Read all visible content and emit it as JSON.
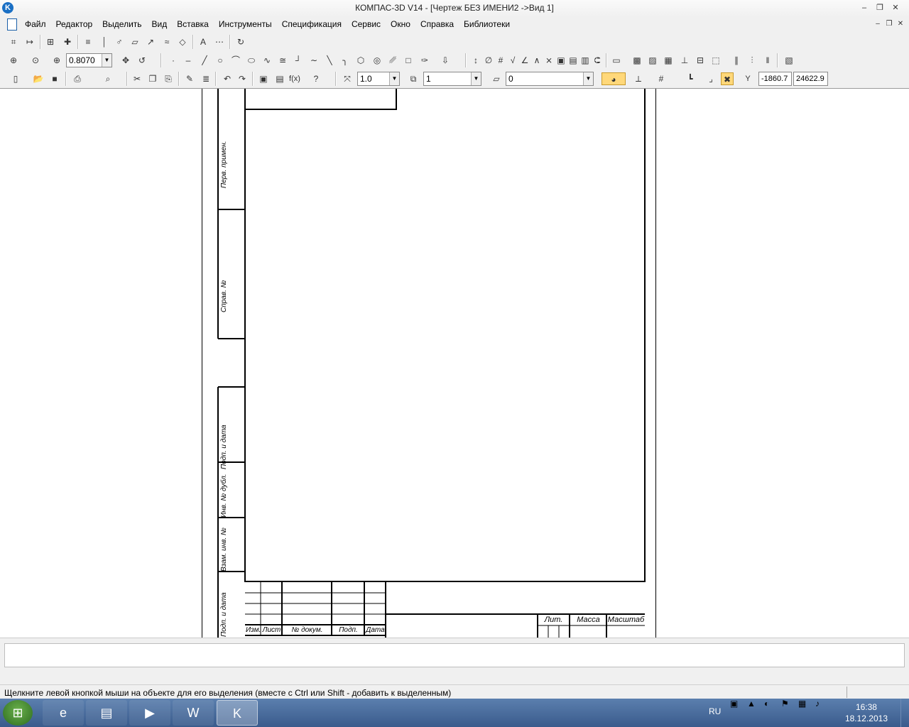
{
  "window": {
    "title": "КОМПАС-3D V14 - [Чертеж БЕЗ ИМЕНИ2 ->Вид 1]",
    "icon": "kompas-logo-icon",
    "controls": [
      "minimize",
      "restore",
      "close"
    ]
  },
  "menubar": {
    "items": [
      "Файл",
      "Редактор",
      "Выделить",
      "Вид",
      "Вставка",
      "Инструменты",
      "Спецификация",
      "Сервис",
      "Окно",
      "Справка",
      "Библиотеки"
    ]
  },
  "toolbar_view": {
    "zoom_value": "0.8070"
  },
  "toolbar_standard": {
    "line_scale": "1.0",
    "view_number": "1",
    "layer_number": "0",
    "coord_x": "-1860.7",
    "coord_y": "24622.9",
    "coord_label": "Y"
  },
  "drawing": {
    "side_stamp_labels": [
      "Перв. примен.",
      "Справ. №",
      "Подп. и дата",
      "Инв. № дубл.",
      "Взам. инв. №",
      "Подп. и дата"
    ],
    "title_block_headers": [
      "Изм.",
      "Лист",
      "№ докум.",
      "Подп.",
      "Дата"
    ],
    "title_block_right_headers": [
      "Лит.",
      "Масса",
      "Масштаб"
    ]
  },
  "status": {
    "message": "Щелкните левой кнопкой мыши на объекте для его выделения (вместе с Ctrl или Shift - добавить к выделенным)"
  },
  "taskbar": {
    "language": "RU",
    "time": "16:38",
    "date": "18.12.2013",
    "apps": [
      "internet-explorer-icon",
      "file-explorer-icon",
      "media-player-icon",
      "word-icon",
      "kompas-icon"
    ],
    "active_app": "kompas-icon"
  },
  "colors": {
    "accent": "#1a6fc4",
    "taskbar": "#3a5b8c",
    "active_toolbar_button": "#ffd87a"
  }
}
